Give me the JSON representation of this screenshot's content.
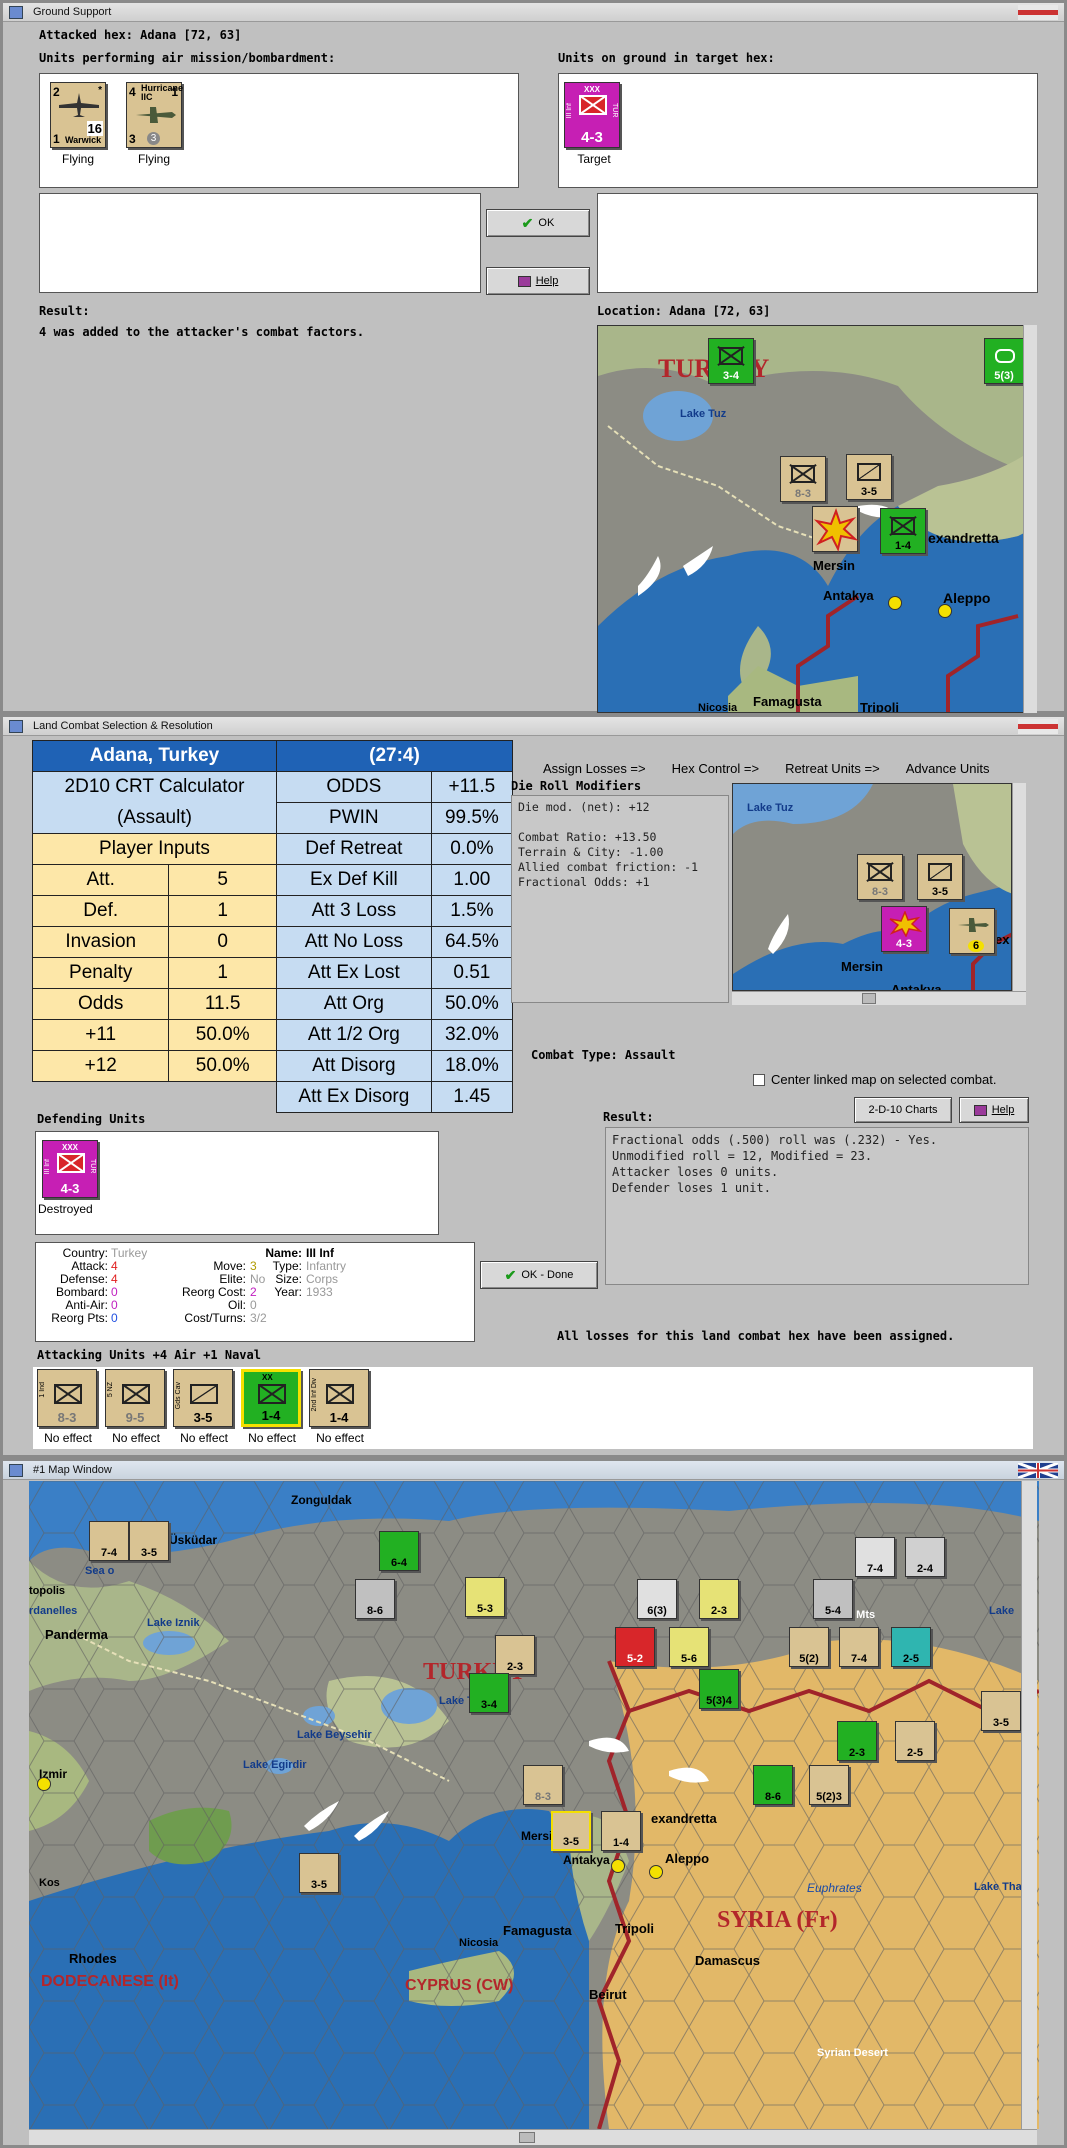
{
  "ground_support": {
    "window_title": "Ground Support",
    "attacked_hex": "Attacked hex: Adana [72, 63]",
    "air_units_label": "Units performing air mission/bombardment:",
    "ground_units_label": "Units on ground in target hex:",
    "air_units": [
      {
        "name": "Warwick",
        "top_left": "2",
        "top_right": "*",
        "strength": "16",
        "bottom_left": "1",
        "caption": "Flying"
      },
      {
        "name": "Hurricane IIC",
        "top_left": "4",
        "top_right": "1",
        "bottom_left": "3",
        "bottom_mid": "3",
        "caption": "Flying"
      }
    ],
    "target_unit": {
      "size": "XXX",
      "side_left": "III Inf",
      "side_right": "TUR",
      "strength": "4-3",
      "caption": "Target"
    },
    "ok_label": "OK",
    "help_label": "Help",
    "result_label": "Result:",
    "result_text": "4 was added to the attacker's combat factors.",
    "location_label": "Location: Adana [72, 63]",
    "map_labels": {
      "country": "TURKEY",
      "lake": "Lake Tuz",
      "mersin": "Mersin",
      "antakya": "Antakya",
      "aleppo": "Aleppo",
      "alexandretta": "exandretta",
      "famagusta": "Famagusta",
      "tripoli": "Tripoli",
      "nicosia": "Nicosia"
    },
    "map_counters": [
      {
        "str": "3-4",
        "badge": "3"
      },
      {
        "str": "8-3"
      },
      {
        "str": "3-5"
      },
      {
        "str": "1-4"
      },
      {
        "str": "5(3)"
      }
    ]
  },
  "land_combat": {
    "window_title": "Land Combat Selection & Resolution",
    "calculator": {
      "header_left": "Adana, Turkey",
      "header_right": "(27:4)",
      "title_line1": "2D10 CRT Calculator",
      "title_line2": "(Assault)",
      "player_inputs": "Player Inputs",
      "inputs": [
        {
          "label": "Att.",
          "value": "5"
        },
        {
          "label": "Def.",
          "value": "1"
        },
        {
          "label": "Invasion",
          "value": "0"
        },
        {
          "label": "Penalty",
          "value": "1"
        },
        {
          "label": "Odds",
          "value": "11.5"
        },
        {
          "label": "+11",
          "value": "50.0%"
        },
        {
          "label": "+12",
          "value": "50.0%"
        }
      ],
      "results": [
        {
          "label": "ODDS",
          "value": "+11.5"
        },
        {
          "label": "PWIN",
          "value": "99.5%"
        },
        {
          "label": "Def Retreat",
          "value": "0.0%"
        },
        {
          "label": "Ex Def Kill",
          "value": "1.00"
        },
        {
          "label": "Att 3 Loss",
          "value": "1.5%"
        },
        {
          "label": "Att No Loss",
          "value": "64.5%"
        },
        {
          "label": "Att Ex Lost",
          "value": "0.51"
        },
        {
          "label": "Att Org",
          "value": "50.0%"
        },
        {
          "label": "Att 1/2 Org",
          "value": "32.0%"
        },
        {
          "label": "Att Disorg",
          "value": "18.0%"
        },
        {
          "label": "Att Ex Disorg",
          "value": "1.45"
        }
      ]
    },
    "phases": [
      "Assign Losses =>",
      "Hex Control =>",
      "Retreat Units =>",
      "Advance Units"
    ],
    "drm_label": "Die Roll Modifiers",
    "drm_lines": [
      "Die mod. (net): +12",
      "",
      "Combat Ratio: +13.50",
      "Terrain & City: -1.00",
      "Allied combat friction: -1",
      "Fractional Odds: +1"
    ],
    "combat_type": "Combat Type: Assault",
    "center_link": "Center linked map on selected combat.",
    "charts_btn": "2-D-10 Charts",
    "help_btn": "Help",
    "result_label": "Result:",
    "result_lines": [
      "Fractional odds (.500) roll was (.232)  - Yes.",
      "Unmodified roll = 12, Modified = 23.",
      "Attacker loses 0 units.",
      "Defender loses 1 unit."
    ],
    "defending_label": "Defending Units",
    "defender": {
      "size": "XXX",
      "side_left": "III Inf",
      "side_right": "TUR",
      "strength": "4-3",
      "caption": "Destroyed"
    },
    "unit_info": {
      "country_label": "Country:",
      "country": "Turkey",
      "attack_label": "Attack:",
      "attack": "4",
      "defense_label": "Defense:",
      "defense": "4",
      "bombard_label": "Bombard:",
      "bombard": "0",
      "antiair_label": "Anti-Air:",
      "antiair": "0",
      "reorg_label": "Reorg Pts:",
      "reorg": "0",
      "move_label": "Move:",
      "move": "3",
      "elite_label": "Elite:",
      "elite": "No",
      "reorgcost_label": "Reorg Cost:",
      "reorgcost": "2",
      "oil_label": "Oil:",
      "oil": "0",
      "costturns_label": "Cost/Turns:",
      "costturns": "3/2",
      "name_label": "Name:",
      "name": "III Inf",
      "type_label": "Type:",
      "type": "Infantry",
      "size_label": "Size:",
      "size": "Corps",
      "year_label": "Year:",
      "year": "1933"
    },
    "ok_done": "OK - Done",
    "all_assigned": "All losses for this land combat hex have been assigned.",
    "attacking_label": "Attacking Units +4 Air +1 Naval",
    "attackers": [
      {
        "side": "1 Ind",
        "strength": "8-3",
        "caption": "No effect",
        "color": "tan"
      },
      {
        "side": "5 NZ",
        "strength": "9-5",
        "caption": "No effect",
        "color": "tan"
      },
      {
        "side": "Gds Cav",
        "strength": "3-5",
        "caption": "No effect",
        "color": "tan"
      },
      {
        "side": "XX",
        "strength": "1-4",
        "caption": "No effect",
        "color": "grn"
      },
      {
        "side": "2nd Inf Div",
        "strength": "1-4",
        "caption": "No effect",
        "color": "tan"
      }
    ],
    "map_labels": {
      "lake": "Lake Tuz",
      "mersin": "Mersin",
      "antakya": "Antakya",
      "ex": "ex"
    },
    "map_counters": [
      {
        "str": "8-3"
      },
      {
        "str": "3-5"
      },
      {
        "str": "4-3"
      },
      {
        "str": "6",
        "badge": "3"
      }
    ]
  },
  "map_window": {
    "window_title": "#1 Map Window",
    "labels": {
      "zonguldak": "Zonguldak",
      "uskudar": "Üsküdar",
      "sea": "Sea o",
      "topolis": "topolis",
      "dardanelles": "rdanelles",
      "panderma": "Panderma",
      "iznik": "Lake Iznik",
      "turkey": "TURKEY",
      "tuz": "Lake Tuz",
      "beysehir": "Lake Beysehir",
      "egirdir": "Lake Egirdir",
      "izmir": "Izmir",
      "kos": "Kos",
      "rhodes": "Rhodes",
      "dodecanese": "DODECANESE (It)",
      "cyprus": "CYPRUS (CW)",
      "nicosia": "Nicosia",
      "famagusta": "Famagusta",
      "mersin": "Mersin",
      "antakya": "Antakya",
      "aleppo": "Aleppo",
      "alexandretta": "exandretta",
      "syria": "SYRIA (Fr)",
      "euphrates": "Euphrates",
      "tripoli": "Tripoli",
      "beirut": "Beirut",
      "damascus": "Damascus",
      "syrian_desert": "Syrian Desert",
      "lake_tha": "Lake Tha",
      "lake": "Lake",
      "mts": "s Mts"
    },
    "counters": [
      {
        "str": "6-4"
      },
      {
        "str": "8-6"
      },
      {
        "str": "5-3"
      },
      {
        "str": "2-3"
      },
      {
        "str": "6(3)"
      },
      {
        "str": "2-3"
      },
      {
        "str": "5-4"
      },
      {
        "str": "7-4"
      },
      {
        "str": "2-4"
      },
      {
        "str": "5-2"
      },
      {
        "str": "5-6"
      },
      {
        "str": "5(2)"
      },
      {
        "str": "7-4"
      },
      {
        "str": "2-5"
      },
      {
        "str": "5(3)4"
      },
      {
        "str": "3-4"
      },
      {
        "str": "2-3"
      },
      {
        "str": "2-5"
      },
      {
        "str": "8-6"
      },
      {
        "str": "5(2)3"
      },
      {
        "str": "8-3"
      },
      {
        "str": "3-5"
      },
      {
        "str": "1-4"
      },
      {
        "str": "3-5"
      },
      {
        "str": "3-5"
      },
      {
        "str": "7-4"
      },
      {
        "str": "3-5"
      }
    ]
  }
}
